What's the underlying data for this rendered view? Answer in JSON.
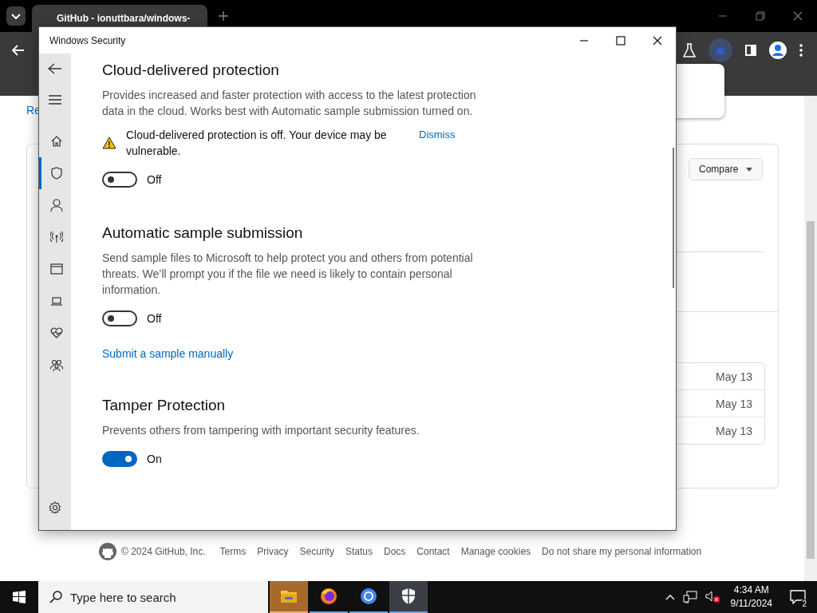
{
  "browser": {
    "tab_title": "GitHub - ionuttbara/windows-",
    "page": {
      "link": "Re",
      "compare_button": "Compare",
      "dates": [
        "May 13",
        "May 13",
        "May 13"
      ],
      "footer": [
        "© 2024 GitHub, Inc.",
        "Terms",
        "Privacy",
        "Security",
        "Status",
        "Docs",
        "Contact",
        "Manage cookies",
        "Do not share my personal information"
      ]
    }
  },
  "security_window": {
    "title": "Windows Security",
    "nav": [
      {
        "kind": "home",
        "selected": false
      },
      {
        "kind": "shield",
        "selected": true
      },
      {
        "kind": "person",
        "selected": false
      },
      {
        "kind": "antenna",
        "selected": false
      },
      {
        "kind": "window",
        "selected": false
      },
      {
        "kind": "laptop",
        "selected": false
      },
      {
        "kind": "heart",
        "selected": false
      },
      {
        "kind": "family",
        "selected": false
      }
    ],
    "sections": [
      {
        "heading": "Cloud-delivered protection",
        "description": "Provides increased and faster protection with access to the latest protection data in the cloud. Works best with Automatic sample submission turned on.",
        "warning": {
          "text": "Cloud-delivered protection is off. Your device may be vulnerable.",
          "action": "Dismiss"
        },
        "toggle": {
          "on": false,
          "label": "Off"
        }
      },
      {
        "heading": "Automatic sample submission",
        "description": "Send sample files to Microsoft to help protect you and others from potential threats. We’ll prompt you if the file we need is likely to contain personal information.",
        "toggle": {
          "on": false,
          "label": "Off"
        },
        "link": "Submit a sample manually"
      },
      {
        "heading": "Tamper Protection",
        "description": "Prevents others from tampering with important security features.",
        "toggle": {
          "on": true,
          "label": "On"
        }
      }
    ]
  },
  "taskbar": {
    "search_placeholder": "Type here to search",
    "apps": [
      {
        "kind": "folder",
        "selected": false
      },
      {
        "kind": "firefox",
        "selected": false
      },
      {
        "kind": "chrome",
        "selected": false
      },
      {
        "kind": "shield",
        "selected": true
      }
    ],
    "time": "4:34 AM",
    "date": "9/11/2024",
    "notifications": "2"
  }
}
